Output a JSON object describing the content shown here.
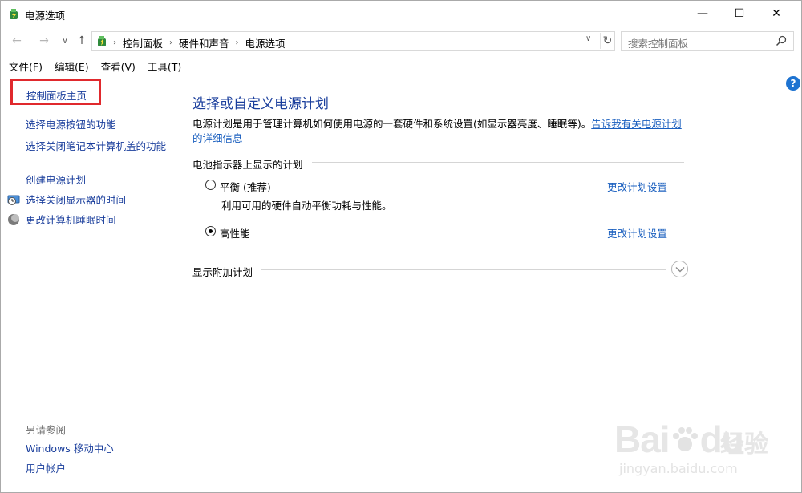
{
  "window": {
    "title": "电源选项",
    "buttons": {
      "minimize": "—",
      "maximize": "☐",
      "close": "✕"
    }
  },
  "nav": {
    "back": "←",
    "forward": "→",
    "recent": "∨",
    "up": "↑",
    "breadcrumbs": [
      "控制面板",
      "硬件和声音",
      "电源选项"
    ],
    "separator": "›",
    "dropdown": "∨",
    "refresh": "↻",
    "search_placeholder": "搜索控制面板"
  },
  "menu": [
    "文件(F)",
    "编辑(E)",
    "查看(V)",
    "工具(T)"
  ],
  "help": "?",
  "left_pane": {
    "home": "控制面板主页",
    "links": [
      "选择电源按钮的功能",
      "选择关闭笔记本计算机盖的功能",
      "创建电源计划",
      "选择关闭显示器的时间",
      "更改计算机睡眠时间"
    ],
    "see_also_title": "另请参阅",
    "see_also": [
      "Windows 移动中心",
      "用户帐户"
    ]
  },
  "main": {
    "title": "选择或自定义电源计划",
    "description": "电源计划是用于管理计算机如何使用电源的一套硬件和系统设置(如显示器亮度、睡眠等)。",
    "description_link": "告诉我有关电源计划的详细信息",
    "battery_section": "电池指示器上显示的计划",
    "plans": [
      {
        "name": "平衡 (推荐)",
        "description": "利用可用的硬件自动平衡功耗与性能。",
        "link": "更改计划设置",
        "selected": false
      },
      {
        "name": "高性能",
        "description": "",
        "link": "更改计划设置",
        "selected": true
      }
    ],
    "more_plans": "显示附加计划",
    "expand": "⌄"
  },
  "watermark": {
    "brand": "Bai",
    "brand2": "du",
    "cn": "经验",
    "url": "jingyan.baidu.com"
  }
}
